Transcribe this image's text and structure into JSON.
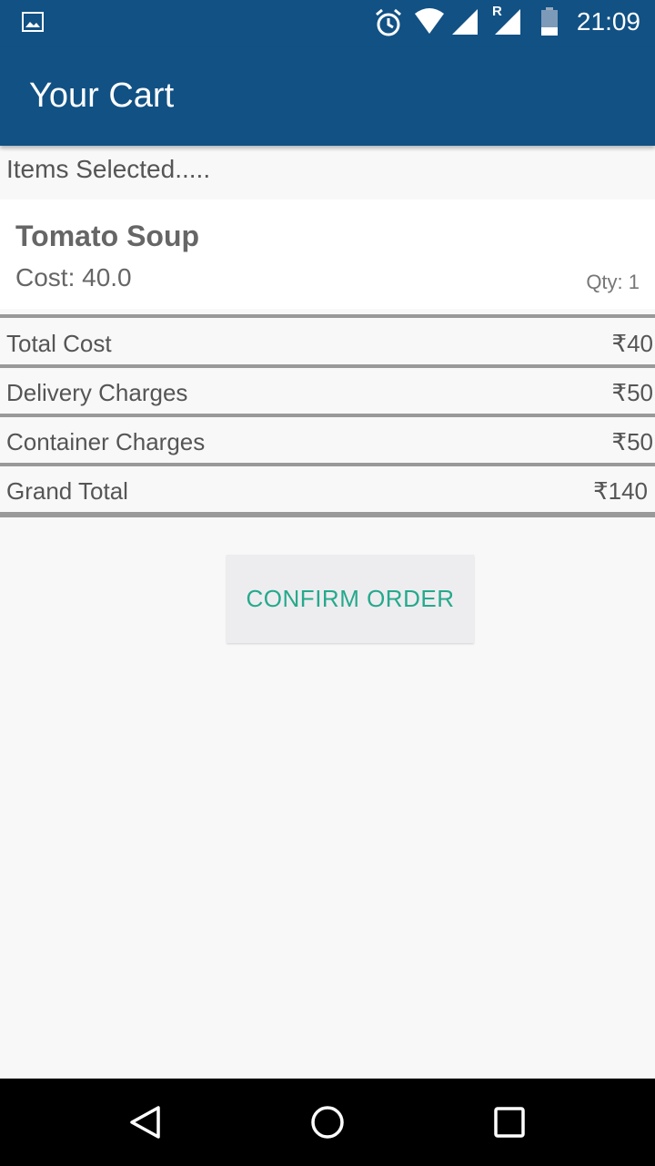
{
  "status_bar": {
    "time": "21:09",
    "icons": [
      "image-icon",
      "alarm-icon",
      "wifi-icon",
      "signal-icon",
      "signal-roaming-icon",
      "battery-icon"
    ],
    "roaming_label": "R"
  },
  "app_bar": {
    "title": "Your Cart",
    "color": "#115184"
  },
  "cart": {
    "section_label": "Items Selected.....",
    "items": [
      {
        "name": "Tomato Soup",
        "cost": "Cost: 40.0",
        "qty": "Qty: 1"
      }
    ]
  },
  "summary": {
    "rows": [
      {
        "label": "Total Cost",
        "value": "₹40"
      },
      {
        "label": "Delivery Charges",
        "value": "₹50"
      },
      {
        "label": "Container Charges",
        "value": "₹50"
      },
      {
        "label": "Grand Total",
        "value": "₹140"
      }
    ]
  },
  "actions": {
    "confirm_label": "CONFIRM ORDER",
    "accent": "#26a98c"
  },
  "nav_bar": {
    "icons": [
      "back-icon",
      "home-icon",
      "recents-icon"
    ]
  }
}
